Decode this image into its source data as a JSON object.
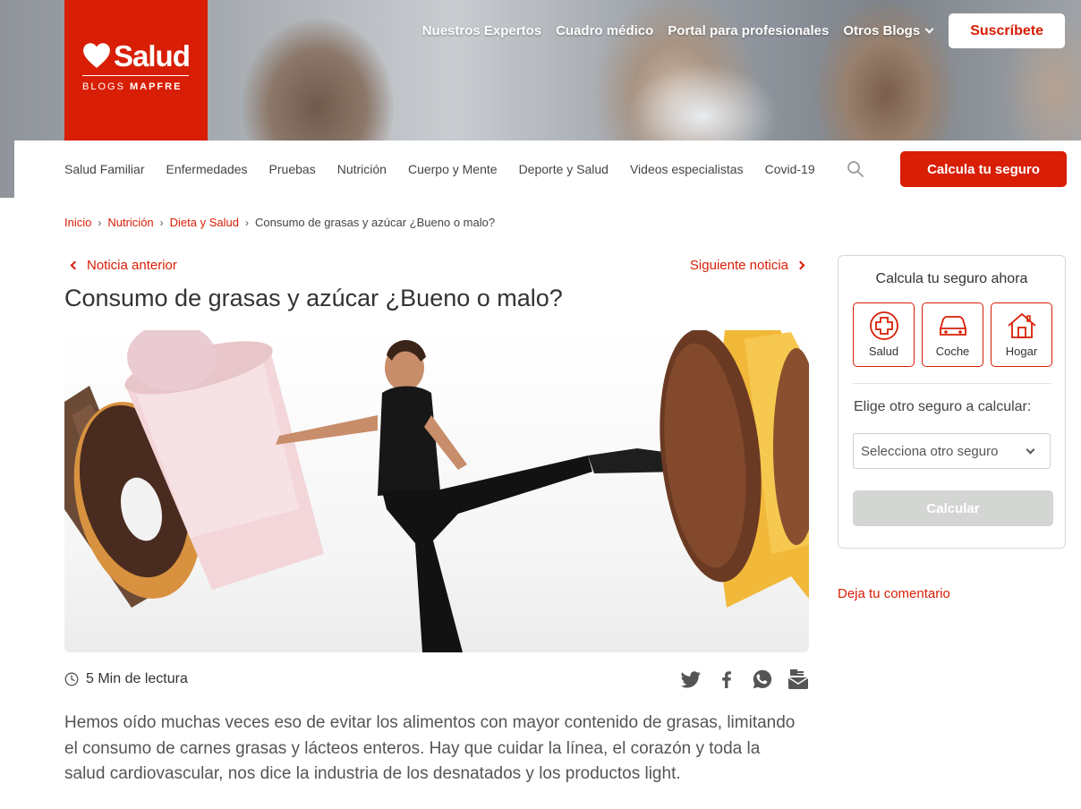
{
  "brand": {
    "logo_text": "Salud",
    "logo_sub_1": "BLOGS",
    "logo_sub_2": "MAPFRE",
    "accent": "#d81e05"
  },
  "topnav": {
    "items": [
      "Nuestros Expertos",
      "Cuadro médico",
      "Portal para profesionales",
      "Otros Blogs"
    ],
    "subscribe": "Suscríbete"
  },
  "subnav": {
    "items": [
      "Salud Familiar",
      "Enfermedades",
      "Pruebas",
      "Nutrición",
      "Cuerpo y Mente",
      "Deporte y Salud",
      "Videos especialistas",
      "Covid-19"
    ],
    "cta": "Calcula tu seguro"
  },
  "breadcrumb": [
    "Inicio",
    "Nutrición",
    "Dieta y Salud",
    "Consumo de grasas y azúcar ¿Bueno o malo?"
  ],
  "article": {
    "prev": "Noticia anterior",
    "next": "Siguiente noticia",
    "title": "Consumo de grasas y azúcar ¿Bueno o malo?",
    "read_time": "5 Min de lectura",
    "share_icons": [
      "twitter-icon",
      "facebook-icon",
      "whatsapp-icon",
      "email-icon"
    ],
    "lead": "Hemos oído muchas veces eso de evitar los alimentos con mayor contenido de grasas, limitando el consumo de carnes grasas y lácteos enteros. Hay que cuidar la línea, el corazón y toda la salud cardiovascular, nos dice la industria de los desnatados y los productos light."
  },
  "sidebar": {
    "title": "Calcula tu seguro ahora",
    "tiles": [
      "Salud",
      "Coche",
      "Hogar"
    ],
    "subtitle": "Elige otro seguro a calcular:",
    "select_value": "Selecciona otro seguro",
    "button": "Calcular",
    "comment": "Deja tu comentario"
  }
}
